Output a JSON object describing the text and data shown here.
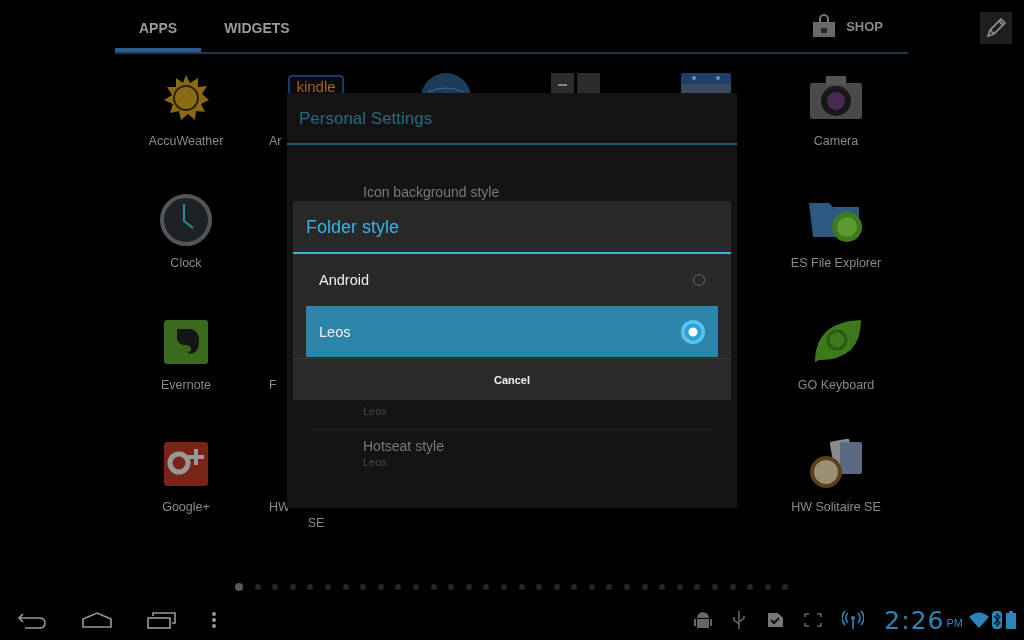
{
  "tabs": [
    {
      "label": "APPS",
      "selected": true
    },
    {
      "label": "WIDGETS",
      "selected": false
    }
  ],
  "shop": {
    "label": "SHOP"
  },
  "apps": [
    {
      "kind": "sun",
      "label": "AccuWeather"
    },
    {
      "kind": "kindle",
      "icon_text": "kindle",
      "label": "Ar",
      "cut": true
    },
    {
      "kind": "globe"
    },
    {
      "kind": "tiles"
    },
    {
      "kind": "calendar"
    },
    {
      "kind": "camera",
      "label": "Camera"
    },
    {
      "kind": "clock",
      "label": "Clock"
    },
    {
      "kind": "covered"
    },
    {
      "kind": "covered"
    },
    {
      "kind": "covered"
    },
    {
      "kind": "covered"
    },
    {
      "kind": "folder",
      "label": "ES File Explorer"
    },
    {
      "kind": "elephant",
      "label": "Evernote"
    },
    {
      "kind": "covered",
      "label": "F",
      "cut": true
    },
    {
      "kind": "covered"
    },
    {
      "kind": "covered"
    },
    {
      "kind": "covered"
    },
    {
      "kind": "leaf",
      "label": "GO Keyboard"
    },
    {
      "kind": "gplus",
      "label": "Google+"
    },
    {
      "kind": "covered",
      "label": "HW",
      "label_2": "SE",
      "cut": true
    },
    {
      "kind": "covered"
    },
    {
      "kind": "covered"
    },
    {
      "kind": "covered"
    },
    {
      "kind": "cards",
      "label": "HW Solitaire SE"
    }
  ],
  "settings_dialog": {
    "title": "Personal Settings",
    "items": [
      {
        "title": "Icon background style"
      },
      {
        "subtitle": "Leos"
      },
      {
        "title": "Hotseat style",
        "subtitle": "Leos"
      }
    ]
  },
  "folder_dialog": {
    "title": "Folder style",
    "options": [
      {
        "label": "Android",
        "selected": false
      },
      {
        "label": "Leos",
        "selected": true
      }
    ],
    "cancel": "Cancel"
  },
  "pages": [
    {
      "selected": true
    },
    {
      "selected": false
    },
    {
      "selected": false
    },
    {
      "selected": false
    },
    {
      "selected": false
    },
    {
      "selected": false
    },
    {
      "selected": false
    },
    {
      "selected": false
    },
    {
      "selected": false
    },
    {
      "selected": false
    },
    {
      "selected": false
    },
    {
      "selected": false
    },
    {
      "selected": false
    },
    {
      "selected": false
    },
    {
      "selected": false
    },
    {
      "selected": false
    },
    {
      "selected": false
    },
    {
      "selected": false
    },
    {
      "selected": false
    },
    {
      "selected": false
    },
    {
      "selected": false
    },
    {
      "selected": false
    },
    {
      "selected": false
    },
    {
      "selected": false
    },
    {
      "selected": false
    },
    {
      "selected": false
    },
    {
      "selected": false
    },
    {
      "selected": false
    },
    {
      "selected": false
    },
    {
      "selected": false
    },
    {
      "selected": false
    },
    {
      "selected": false
    }
  ],
  "status": {
    "time": "2:26",
    "ampm": "PM"
  }
}
